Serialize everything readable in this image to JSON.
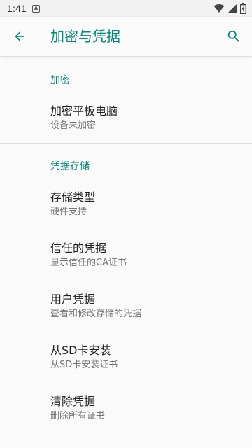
{
  "status_bar": {
    "time": "1:41",
    "notification_glyph": "A",
    "icons": [
      "wifi-icon",
      "cell-signal-icon",
      "battery-icon"
    ]
  },
  "app_bar": {
    "title": "加密与凭据",
    "back_icon": "arrow-back-icon",
    "search_icon": "search-icon"
  },
  "sections": {
    "encryption": {
      "header": "加密",
      "items": [
        {
          "title": "加密平板电脑",
          "summary": "设备未加密"
        }
      ]
    },
    "credential_storage": {
      "header": "凭据存储",
      "items": [
        {
          "title": "存储类型",
          "summary": "硬件支持"
        },
        {
          "title": "信任的凭据",
          "summary": "显示信任的CA证书"
        },
        {
          "title": "用户凭据",
          "summary": "查看和修改存储的凭据"
        },
        {
          "title": "从SD卡安装",
          "summary": "从SD卡安装证书"
        },
        {
          "title": "清除凭据",
          "summary": "删除所有证书"
        }
      ]
    }
  },
  "colors": {
    "accent": "#00897b",
    "background": "#fafafa",
    "title_text": "#212121",
    "summary_text": "#757575"
  }
}
